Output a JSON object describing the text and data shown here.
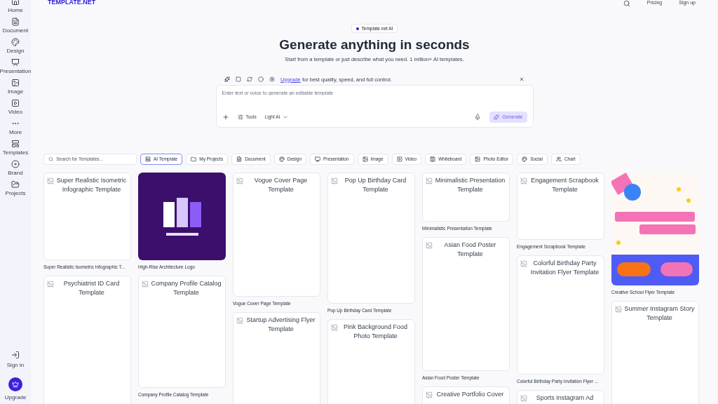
{
  "header": {
    "logo": "TEMPLATE.NET",
    "nav": [
      "Pricing",
      "Sign up"
    ]
  },
  "sidebar": {
    "items": [
      {
        "label": "Home"
      },
      {
        "label": "Document"
      },
      {
        "label": "Design"
      },
      {
        "label": "Presentation"
      },
      {
        "label": "Image"
      },
      {
        "label": "Video"
      },
      {
        "label": "More"
      },
      {
        "label": "Templates"
      },
      {
        "label": "Brand"
      },
      {
        "label": "Projects"
      }
    ],
    "bottom": [
      {
        "label": "Sign in"
      },
      {
        "label": "Upgrade"
      }
    ]
  },
  "hero": {
    "badge": "Template.net AI",
    "title": "Generate anything in seconds",
    "subtitle": "Start from a template or just describe what you need. 1 million+ AI templates."
  },
  "upgrade_bar": {
    "link": "Upgrade",
    "text": "for best quality, speed, and full control."
  },
  "prompt": {
    "placeholder": "Enter text or voice to generate an editable template",
    "tools": "Tools",
    "model": "Light AI",
    "generate": {
      "label": "Generate",
      "disabled": true
    }
  },
  "search": {
    "placeholder": "Search for Templates..."
  },
  "filters": [
    {
      "label": "AI Template",
      "selected": true
    },
    {
      "label": "My Projects",
      "selected": false
    },
    {
      "label": "Document",
      "selected": false
    },
    {
      "label": "Design",
      "selected": false
    },
    {
      "label": "Presentation",
      "selected": false
    },
    {
      "label": "Image",
      "selected": false
    },
    {
      "label": "Video",
      "selected": false
    },
    {
      "label": "Whiteboard",
      "selected": false
    },
    {
      "label": "Photo Editor",
      "selected": false
    },
    {
      "label": "Social",
      "selected": false
    },
    {
      "label": "Chart",
      "selected": false
    }
  ],
  "columns": [
    {
      "cards": [
        {
          "kind": "broken",
          "alt": "Super Realistic Isometric Infographic Template",
          "caption": "Super Realistic Isometric Infographic T..."
        },
        {
          "kind": "broken",
          "alt": "Psychiatrist ID Card Template"
        }
      ]
    },
    {
      "cards": [
        {
          "kind": "logo",
          "caption": "High-Rise Architecture Logo"
        },
        {
          "kind": "broken",
          "alt": "Company Profile Catalog Template",
          "caption": "Company Profile Catalog Template"
        }
      ]
    },
    {
      "cards": [
        {
          "kind": "broken",
          "alt": "Vogue Cover Page Template",
          "caption": "Vogue Cover Page Template"
        },
        {
          "kind": "broken",
          "alt": "Startup Advertising Flyer Template"
        }
      ]
    },
    {
      "cards": [
        {
          "kind": "broken",
          "alt": "Pop Up Birthday Card Template",
          "caption": "Pop Up Birthday Card Template"
        },
        {
          "kind": "broken",
          "alt": "Pink Background Food Photo Template"
        }
      ]
    },
    {
      "cards": [
        {
          "kind": "broken",
          "alt": "Minimalistic Presentation Template",
          "caption": "Minimalistic Presentation Template"
        },
        {
          "kind": "broken",
          "alt": "Asian Food Poster Template",
          "caption": "Asian Food Poster Template"
        },
        {
          "kind": "broken",
          "alt": "Creative Portfolio Cover"
        }
      ]
    },
    {
      "cards": [
        {
          "kind": "broken",
          "alt": "Engagement Scrapbook Template",
          "caption": "Engagement Scrapbook Template"
        },
        {
          "kind": "broken",
          "alt": "Colorful Birthday Party Invitation Flyer Template",
          "caption": "Colorful Birthday Party Invitation Flyer ..."
        },
        {
          "kind": "broken",
          "alt": "Sports Instagram Ad"
        }
      ]
    },
    {
      "cards": [
        {
          "kind": "flyer",
          "caption": "Creative School Flyer Template"
        },
        {
          "kind": "broken",
          "alt": "Summer Instagram Story Template"
        }
      ]
    }
  ]
}
